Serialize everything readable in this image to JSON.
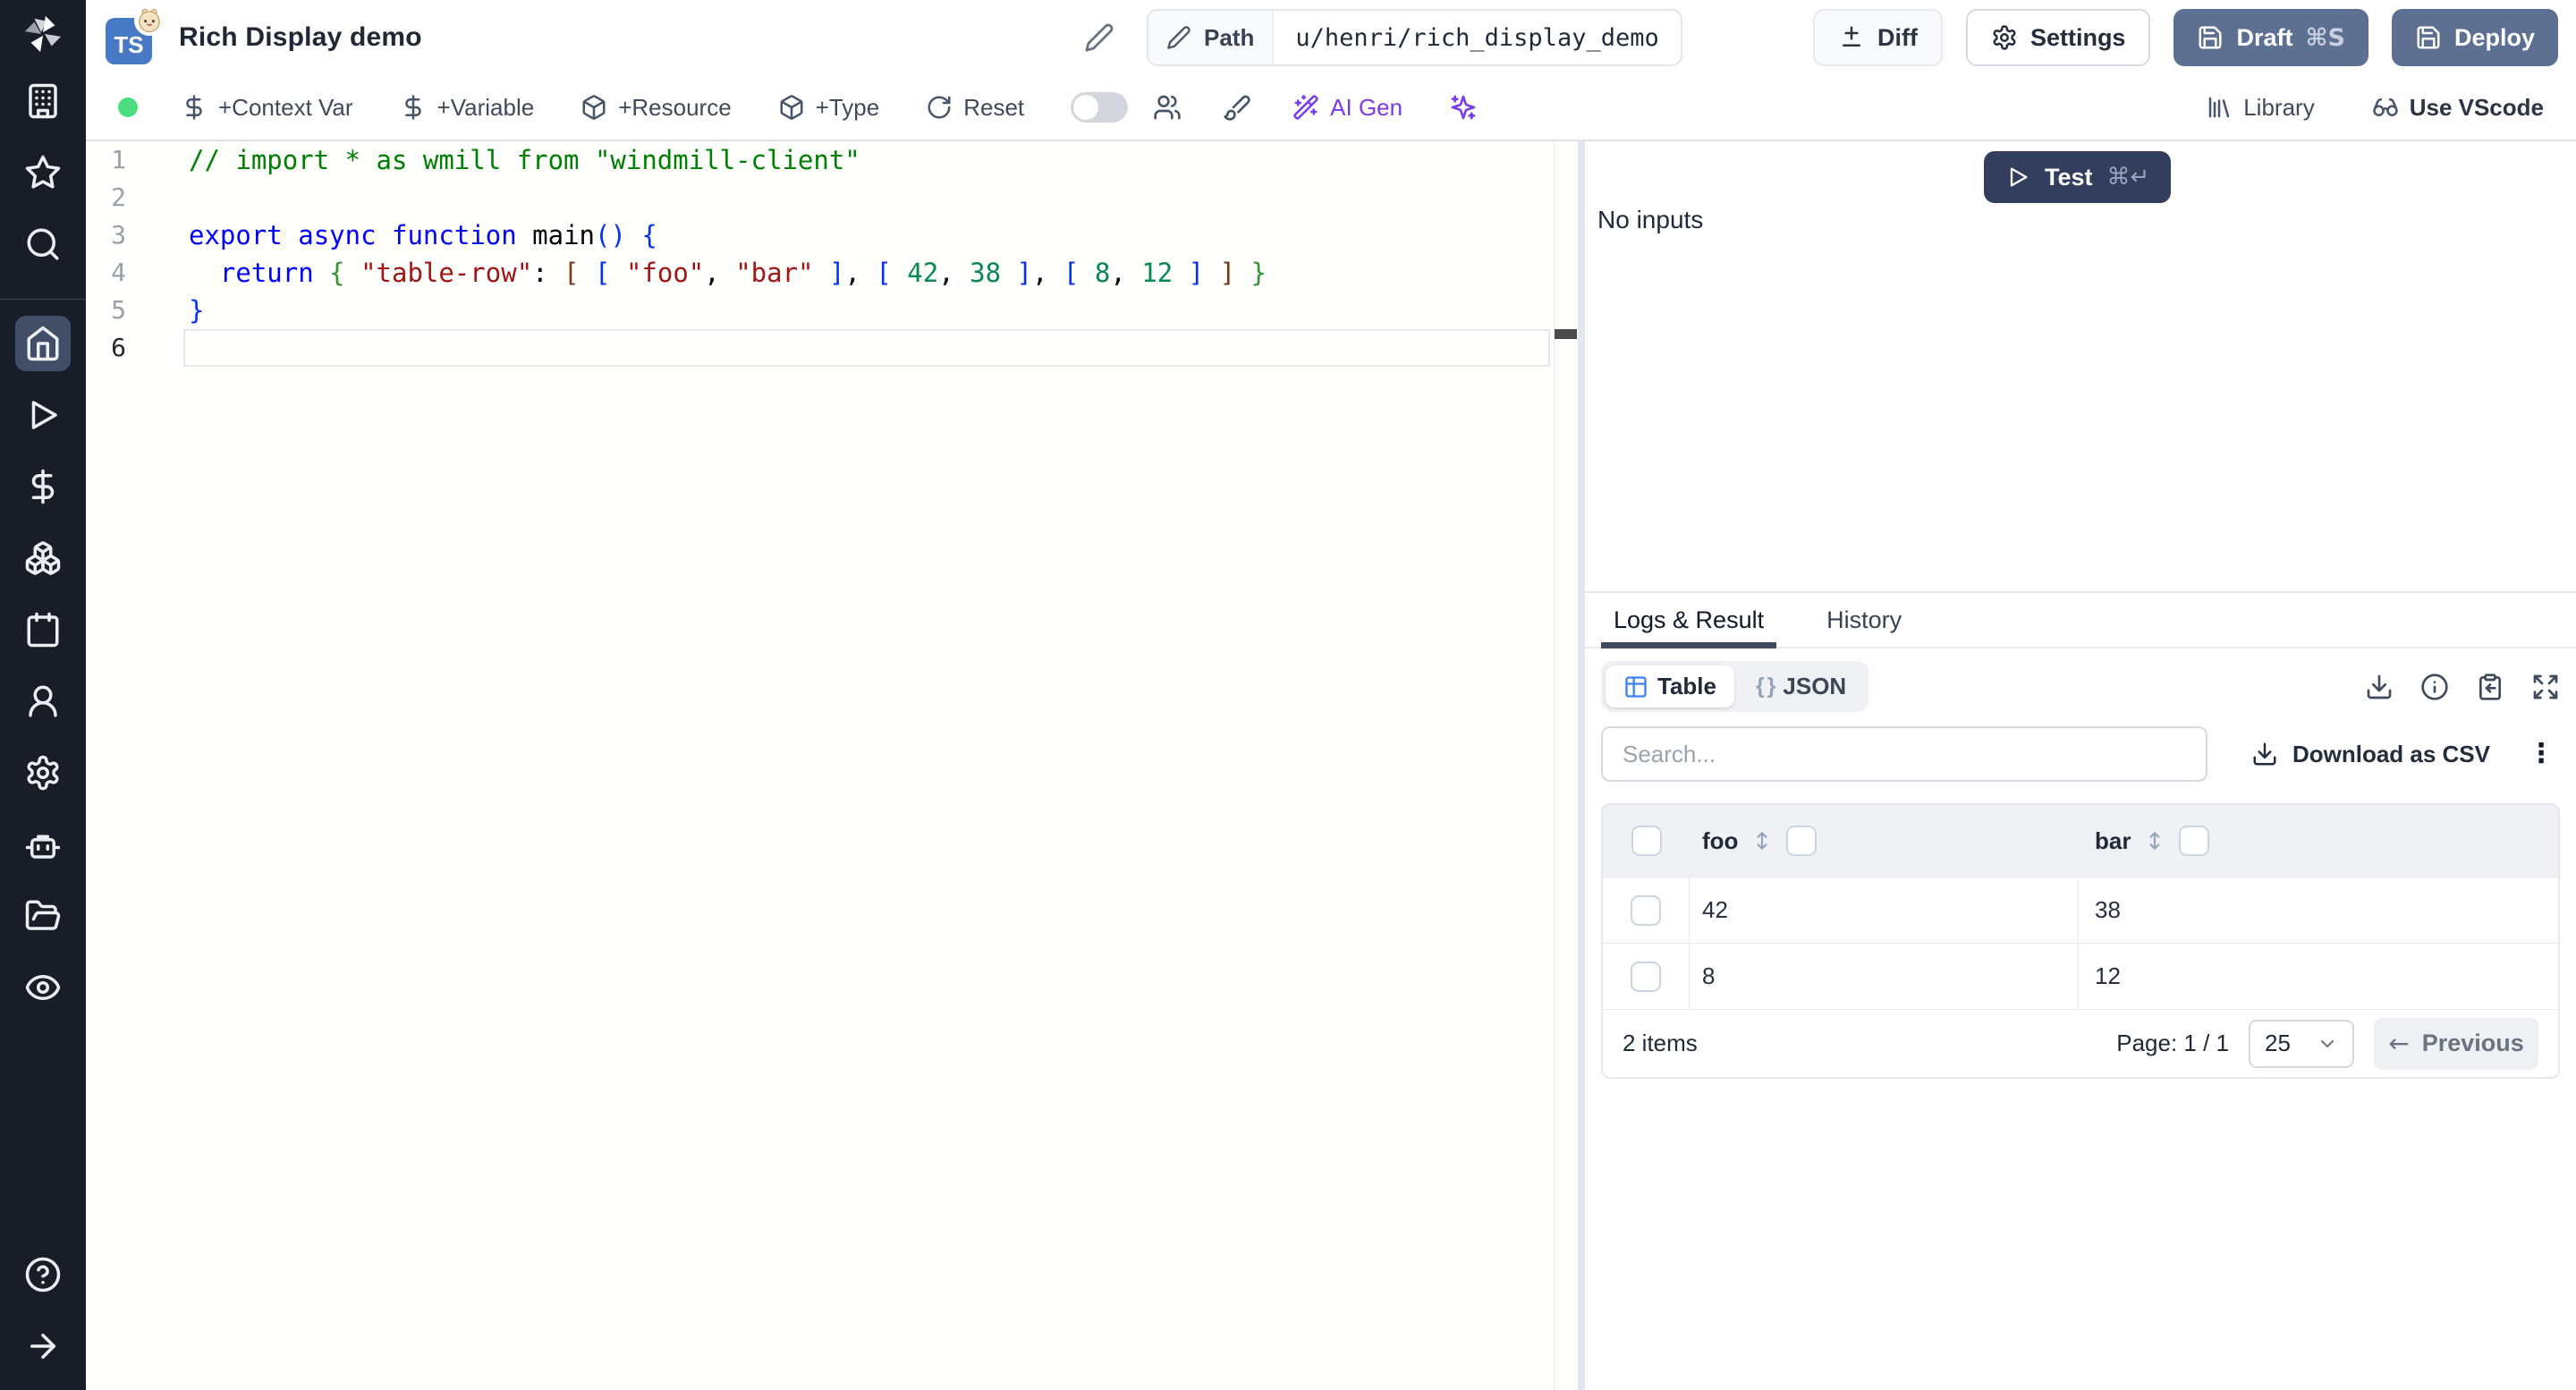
{
  "header": {
    "title": "Rich Display demo",
    "lang_badge": "TS",
    "path_label": "Path",
    "path_value": "u/henri/rich_display_demo",
    "diff_label": "Diff",
    "settings_label": "Settings",
    "draft_label": "Draft",
    "draft_shortcut": "⌘S",
    "deploy_label": "Deploy"
  },
  "toolbar": {
    "context_var": "+Context Var",
    "variable": "+Variable",
    "resource": "+Resource",
    "type": "+Type",
    "reset": "Reset",
    "ai_gen": "AI Gen",
    "library": "Library",
    "use_vscode": "Use VScode"
  },
  "editor": {
    "lines": [
      {
        "n": 1,
        "tokens": [
          [
            "cm",
            "// import * as wmill from \"windmill-client\""
          ]
        ]
      },
      {
        "n": 2,
        "tokens": []
      },
      {
        "n": 3,
        "tokens": [
          [
            "kw",
            "export"
          ],
          [
            "pl",
            " "
          ],
          [
            "kw",
            "async"
          ],
          [
            "pl",
            " "
          ],
          [
            "kw",
            "function"
          ],
          [
            "pl",
            " "
          ],
          [
            "pl",
            "main"
          ],
          [
            "b1",
            "()"
          ],
          [
            "pl",
            " "
          ],
          [
            "b1",
            "{"
          ]
        ]
      },
      {
        "n": 4,
        "tokens": [
          [
            "pl",
            "  "
          ],
          [
            "kw",
            "return"
          ],
          [
            "pl",
            " "
          ],
          [
            "b2",
            "{"
          ],
          [
            "pl",
            " "
          ],
          [
            "str",
            "\"table-row\""
          ],
          [
            "pl",
            ": "
          ],
          [
            "b3",
            "["
          ],
          [
            "pl",
            " "
          ],
          [
            "b1",
            "["
          ],
          [
            "pl",
            " "
          ],
          [
            "str",
            "\"foo\""
          ],
          [
            "pl",
            ", "
          ],
          [
            "str",
            "\"bar\""
          ],
          [
            "pl",
            " "
          ],
          [
            "b1",
            "]"
          ],
          [
            "pl",
            ", "
          ],
          [
            "b1",
            "["
          ],
          [
            "pl",
            " "
          ],
          [
            "num",
            "42"
          ],
          [
            "pl",
            ", "
          ],
          [
            "num",
            "38"
          ],
          [
            "pl",
            " "
          ],
          [
            "b1",
            "]"
          ],
          [
            "pl",
            ", "
          ],
          [
            "b1",
            "["
          ],
          [
            "pl",
            " "
          ],
          [
            "num",
            "8"
          ],
          [
            "pl",
            ", "
          ],
          [
            "num",
            "12"
          ],
          [
            "pl",
            " "
          ],
          [
            "b1",
            "]"
          ],
          [
            "pl",
            " "
          ],
          [
            "b3",
            "]"
          ],
          [
            "pl",
            " "
          ],
          [
            "b2",
            "}"
          ]
        ]
      },
      {
        "n": 5,
        "tokens": [
          [
            "b1",
            "}"
          ]
        ]
      },
      {
        "n": 6,
        "tokens": [],
        "current": true
      }
    ]
  },
  "run_panel": {
    "test_label": "Test",
    "test_shortcut": "⌘↵",
    "no_inputs": "No inputs"
  },
  "result_panel": {
    "tabs": {
      "logs": "Logs & Result",
      "history": "History"
    },
    "views": {
      "table": "Table",
      "json": "JSON",
      "json_icon": "{ }"
    },
    "search_placeholder": "Search...",
    "download_csv": "Download as CSV",
    "kebab": "⋮",
    "table": {
      "columns": [
        "foo",
        "bar"
      ],
      "rows": [
        [
          "42",
          "38"
        ],
        [
          "8",
          "12"
        ]
      ],
      "items_count": "2 items",
      "page_label": "Page: 1 / 1",
      "page_size": "25",
      "previous_label": "Previous",
      "previous_arrow": "←"
    }
  },
  "colors": {
    "sidebar_bg": "#191d28",
    "sidebar_active": "#424d68",
    "slate_button": "#5e7092",
    "test_button": "#333e5e",
    "accent_violet": "#7c3aed",
    "status_green": "#4ade80",
    "table_icon_blue": "#3b82f6",
    "ts_badge_blue": "#4779c4"
  }
}
